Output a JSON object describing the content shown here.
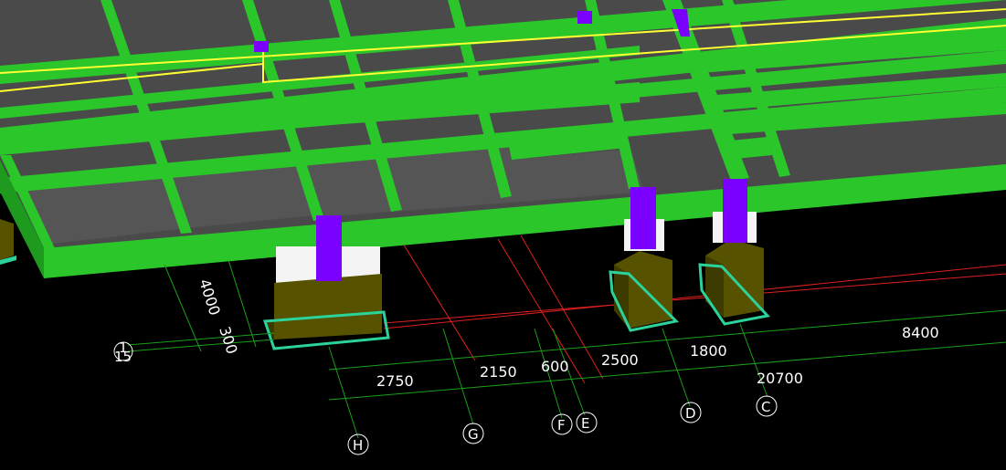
{
  "scene": {
    "background": "#000000",
    "colors": {
      "slab": "#4a4a4a",
      "beam": "#2ac62a",
      "beam_dark": "#1e9a1e",
      "column": "#7a00ff",
      "footing": "#565200",
      "footing_dark": "#3e3b00",
      "footing_base": "#2bd39a",
      "pedestal": "#f4f4f4",
      "rebar_line": "#ffff33",
      "grid_line": "#1aa01a",
      "axis_line": "#e02020"
    }
  },
  "dimensions": {
    "vertical_4000": "4000",
    "vertical_300": "300",
    "d_2750": "2750",
    "d_2150": "2150",
    "d_600": "600",
    "d_2500": "2500",
    "d_1800": "1800",
    "d_8400": "8400",
    "total_20700": "20700"
  },
  "axes": {
    "row_1": "1",
    "row_15": "15",
    "H": "H",
    "G": "G",
    "F": "F",
    "E": "E",
    "D": "D",
    "C": "C"
  }
}
